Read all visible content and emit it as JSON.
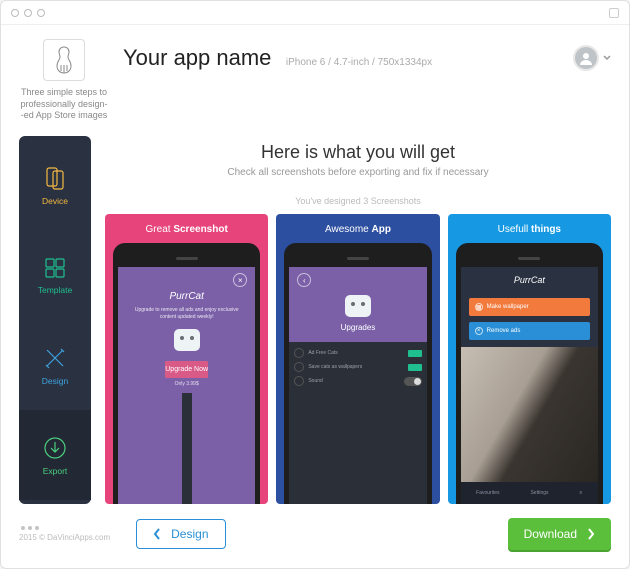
{
  "header": {
    "tagline": "Three simple steps to professionally design--ed App Store images",
    "app_name": "Your app name",
    "device_meta": "iPhone 6 / 4.7-inch / 750x1334px"
  },
  "sidebar": {
    "items": [
      {
        "label": "Device"
      },
      {
        "label": "Template"
      },
      {
        "label": "Design"
      },
      {
        "label": "Export"
      }
    ]
  },
  "preview": {
    "heading": "Here is what you will get",
    "subheading": "Check all screenshots before exporting and fix if necessary",
    "count_text": "You've designed 3 Screenshots"
  },
  "shots": [
    {
      "caption_a": "Great",
      "caption_b": "Screenshot",
      "app_title": "PurrCat",
      "promo": "Upgrade to remove all ads and enjoy exclusive content updated weekly!",
      "cta": "Upgrade Now",
      "price": "Only 3.99$"
    },
    {
      "caption_a": "Awesome",
      "caption_b": "App",
      "section": "Upgrades",
      "rows": [
        "Ad Free Cats",
        "Save cats as wallpapers",
        "Sound"
      ]
    },
    {
      "caption_a": "Usefull",
      "caption_b": "things",
      "app_title": "PurrCat",
      "actions": [
        "Make wallpaper",
        "Remove ads"
      ],
      "tabs": [
        "Favourites",
        "Settings"
      ]
    }
  ],
  "footer": {
    "copyright": "2015 © DaVinciApps.com",
    "back_label": "Design",
    "download_label": "Download"
  }
}
